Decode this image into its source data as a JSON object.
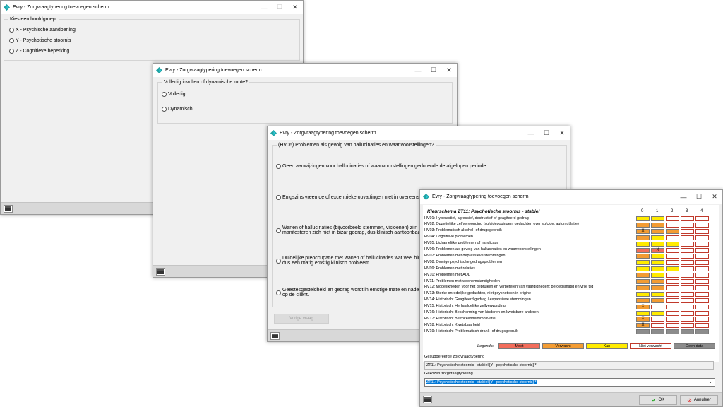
{
  "window_title": "Evry - Zorgvraagtypering toevoegen scherm",
  "colors": {
    "moet": "#f26d5b",
    "verwacht": "#f39c33",
    "kan": "#ffeb00",
    "niet_verwacht": "#ffffff",
    "geen_data": "#8c8c8c",
    "accent": "#0078d7"
  },
  "win1": {
    "legend": "Kies een hoofdgroep:",
    "options": [
      "X - Psychische aandoening",
      "Y - Psychotische stoornis",
      "Z - Cognitieve beperking"
    ]
  },
  "win2": {
    "legend": "Volledig invullen of dynamische route?",
    "options": [
      "Volledig",
      "Dynamisch"
    ]
  },
  "win3": {
    "legend": "(HV06) Problemen als gevolg van hallucinaties en waanvoorstellingen?",
    "options": [
      [
        "Geen aanwijzingen voor hallucinaties of waanvoorstellingen gedurende de afgelopen periode."
      ],
      [
        "Enigszins vreemde of excentrieke opvattingen niet in overeenste"
      ],
      [
        "Wanen of hallucinaties (bijvoorbeeld stemmen, visioenen) zijn a",
        "manifesteren zich niet in bizar gedrag, dus klinisch aantoonbaar"
      ],
      [
        "Duidelijke preoccupatie met wanen of hallucinaties wat veel hin",
        "dus een matig ernstig klinisch probleem."
      ],
      [
        "Geestesgesteldheid en gedrag wordt in ernstige mate en nadelig",
        "op de cliënt."
      ]
    ],
    "prev_button": "Vorige vraag"
  },
  "win4": {
    "schema_title": "Kleurschema ZT11: Psychotische stoornis - stabiel",
    "col_headers": [
      "0",
      "1",
      "2",
      "3",
      "4"
    ],
    "rows": [
      {
        "label": "HV01: Hyperactief, agressief, destructief of geagiteerd gedrag",
        "cells": [
          "K",
          "K",
          "N",
          "N",
          "N"
        ],
        "x": -1
      },
      {
        "label": "HV02: Opzettelijke zelfverwonding (suïcidepogingen, gedachten over suïcide, automutilatie)",
        "cells": [
          "V",
          "V",
          "N",
          "N",
          "N"
        ],
        "x": -1
      },
      {
        "label": "HV03: Problematisch alcohol- of drugsgebruik",
        "cells": [
          "V",
          "V",
          "V",
          "N",
          "N"
        ],
        "x": 0
      },
      {
        "label": "HV04: Cognitieve problemen",
        "cells": [
          "V",
          "K",
          "N",
          "N",
          "N"
        ],
        "x": -1
      },
      {
        "label": "HV05: Lichamelijke problemen of handicaps",
        "cells": [
          "K",
          "K",
          "K",
          "N",
          "N"
        ],
        "x": -1
      },
      {
        "label": "HV06: Problemen als gevolg van hallucinaties en waanvoorstellingen",
        "cells": [
          "M",
          "M",
          "N",
          "N",
          "N"
        ],
        "x": 1
      },
      {
        "label": "HV07: Problemen met depressieve stemmingen",
        "cells": [
          "V",
          "K",
          "N",
          "N",
          "N"
        ],
        "x": -1
      },
      {
        "label": "HV08: Overige psychische gedragsproblemen",
        "cells": [
          "K",
          "K",
          "N",
          "N",
          "N"
        ],
        "x": -1
      },
      {
        "label": "HV09: Problemen met relaties",
        "cells": [
          "K",
          "K",
          "K",
          "N",
          "N"
        ],
        "x": -1
      },
      {
        "label": "HV10: Problemen met ADL",
        "cells": [
          "V",
          "K",
          "N",
          "N",
          "N"
        ],
        "x": -1
      },
      {
        "label": "HV11: Problemen met woonomstandigheden",
        "cells": [
          "V",
          "V",
          "N",
          "N",
          "N"
        ],
        "x": -1
      },
      {
        "label": "HV12: Mogelijkheden voor het gebruiken en verbeteren van vaardigheden: beroepsmatig en vrije tijd",
        "cells": [
          "V",
          "V",
          "N",
          "N",
          "N"
        ],
        "x": -1
      },
      {
        "label": "HV13: Sterke onredelijke gedachten, niet psychotisch in origine",
        "cells": [
          "K",
          "K",
          "N",
          "N",
          "N"
        ],
        "x": -1
      },
      {
        "label": "HV14: Historisch: Geagiteerd gedrag / expansieve stemmingen",
        "cells": [
          "V",
          "V",
          "N",
          "N",
          "N"
        ],
        "x": -1
      },
      {
        "label": "HV15: Historisch: Herhaaldelijke zelfverwonding",
        "cells": [
          "V",
          "N",
          "N",
          "N",
          "N"
        ],
        "x": 0
      },
      {
        "label": "HV16: Historisch: Bescherming van kinderen en kwetsbare anderen",
        "cells": [
          "K",
          "K",
          "N",
          "N",
          "N"
        ],
        "x": -1
      },
      {
        "label": "HV17: Historisch: Betrokkenheid/motivatie",
        "cells": [
          "V",
          "N",
          "N",
          "N",
          "N"
        ],
        "x": 0
      },
      {
        "label": "HV18: Historisch: Kwetsbaarheid",
        "cells": [
          "V",
          "N",
          "N",
          "N",
          "N"
        ],
        "x": 0
      },
      {
        "label": "HV19: Historisch: Problematisch drank- of drugsgebruik",
        "cells": [
          "G",
          "G",
          "G",
          "G",
          "G"
        ],
        "x": -1
      }
    ],
    "legend_label": "Legenda:",
    "legend_items": [
      "Moet",
      "Verwacht",
      "Kan",
      "Niet verwacht",
      "Geen data"
    ],
    "suggested_label": "Gesuggereerde zorgvraagtypering",
    "suggested_value": "ZT11: Psychotische stoornis - stabiel [Y - psychotische stoornis] *",
    "chosen_label": "Gekozen zorgvraagtypering",
    "chosen_value": "ZT11: Psychotische stoornis - stabiel [Y - psychotische stoornis] *",
    "ok_button": "OK",
    "cancel_button": "Annuleer",
    "x_mark": "X"
  }
}
